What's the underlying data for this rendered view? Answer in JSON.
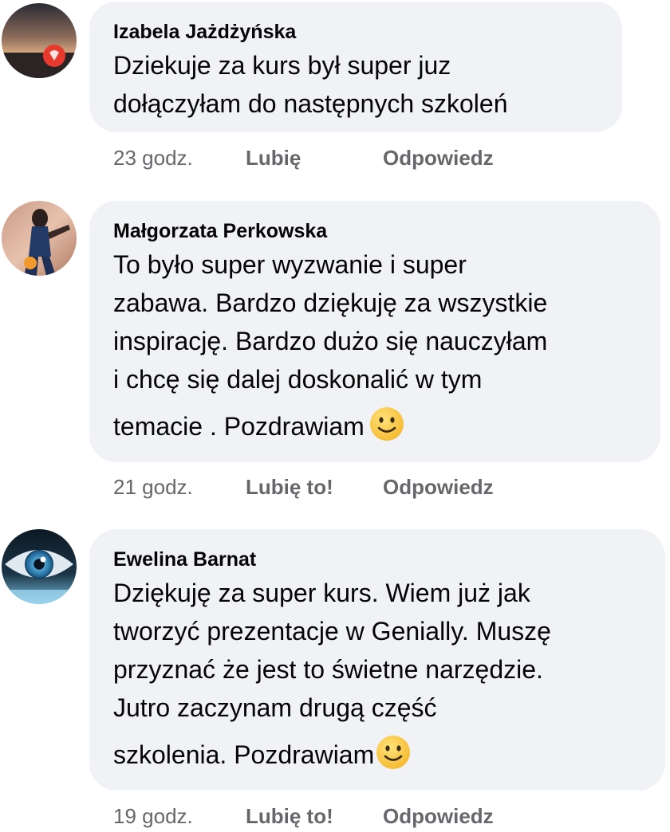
{
  "comments": [
    {
      "author": "Izabela Jażdżyńska",
      "lines": [
        "Dziekuje za kurs był super juz",
        "dołączyłam do następnych szkoleń"
      ],
      "time": "23 godz.",
      "like": "Lubię",
      "reply": "Odpowiedz",
      "avatar_icon": "profile-photo-sunset-heart"
    },
    {
      "author": "Małgorzata Perkowska",
      "lines": [
        "To było super wyzwanie i super",
        "zabawa. Bardzo dziękuję za wszystkie",
        "inspirację. Bardzo dużo się nauczyłam",
        "i chcę się dalej doskonalić w tym",
        "temacie . Pozdrawiam"
      ],
      "emoji": "slightly-smiling-face",
      "time": "21 godz.",
      "like": "Lubię to!",
      "reply": "Odpowiedz",
      "avatar_icon": "profile-photo-woman-dancing"
    },
    {
      "author": "Ewelina Barnat",
      "lines": [
        "Dziękuję za super kurs. Wiem już jak",
        "tworzyć prezentacje w Genially. Muszę",
        "przyznać że jest to świetne narzędzie.",
        "Jutro zaczynam drugą część",
        "szkolenia. Pozdrawiam"
      ],
      "emoji": "slightly-smiling-face",
      "time": "19 godz.",
      "like": "Lubię to!",
      "reply": "Odpowiedz",
      "avatar_icon": "profile-photo-blue-eye"
    }
  ],
  "colors": {
    "bubble_bg": "#f0f2f5",
    "text": "#050505",
    "meta_text": "#65676b",
    "emoji_face": "#f7c23b"
  }
}
